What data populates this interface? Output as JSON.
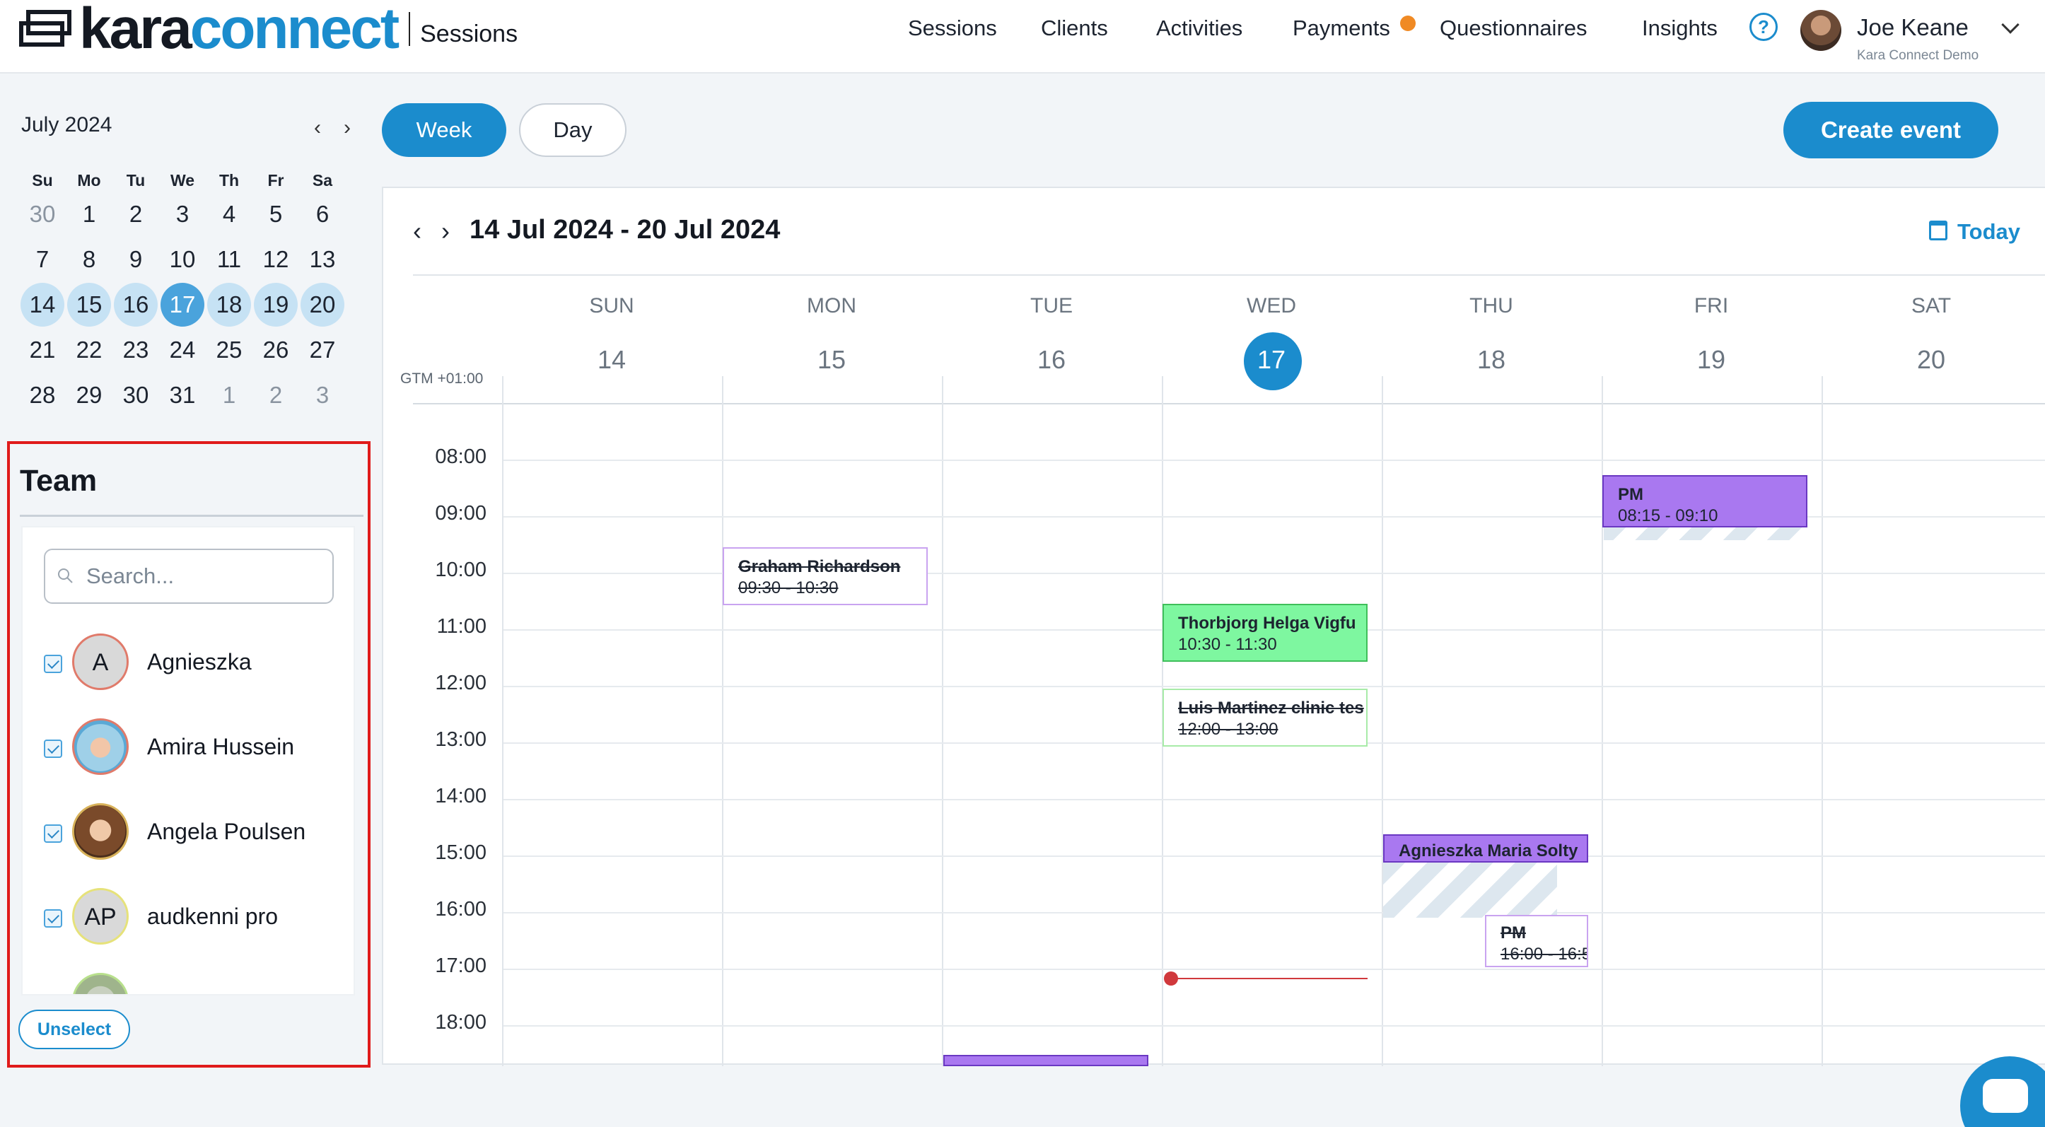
{
  "header": {
    "logo_part1": "kara",
    "logo_part2": "connect",
    "section": "Sessions",
    "nav": [
      "Sessions",
      "Clients",
      "Activities",
      "Payments",
      "Questionnaires",
      "Insights"
    ],
    "payments_badge": "!",
    "help": "?",
    "user_name": "Joe Keane",
    "user_org": "Kara Connect Demo"
  },
  "mini_calendar": {
    "title": "July 2024",
    "prev": "‹",
    "next": "›",
    "dow": [
      "Su",
      "Mo",
      "Tu",
      "We",
      "Th",
      "Fr",
      "Sa"
    ],
    "weeks": [
      [
        "30",
        "1",
        "2",
        "3",
        "4",
        "5",
        "6"
      ],
      [
        "7",
        "8",
        "9",
        "10",
        "11",
        "12",
        "13"
      ],
      [
        "14",
        "15",
        "16",
        "17",
        "18",
        "19",
        "20"
      ],
      [
        "21",
        "22",
        "23",
        "24",
        "25",
        "26",
        "27"
      ],
      [
        "28",
        "29",
        "30",
        "31",
        "1",
        "2",
        "3"
      ]
    ],
    "today": "17"
  },
  "team": {
    "title": "Team",
    "search_placeholder": "Search...",
    "members": [
      {
        "name": "Agnieszka",
        "initials": "A"
      },
      {
        "name": "Amira Hussein",
        "initials": ""
      },
      {
        "name": "Angela Poulsen",
        "initials": ""
      },
      {
        "name": "audkenni pro",
        "initials": "AP"
      }
    ],
    "unselect_label": "Unselect"
  },
  "toolbar": {
    "week_label": "Week",
    "day_label": "Day",
    "create_label": "Create event"
  },
  "calendar": {
    "prev": "‹",
    "next": "›",
    "range": "14 Jul 2024 - 20 Jul 2024",
    "today_label": "Today",
    "timezone": "GTM +01:00",
    "days": [
      {
        "dow": "SUN",
        "num": "14"
      },
      {
        "dow": "MON",
        "num": "15"
      },
      {
        "dow": "TUE",
        "num": "16"
      },
      {
        "dow": "WED",
        "num": "17"
      },
      {
        "dow": "THU",
        "num": "18"
      },
      {
        "dow": "FRI",
        "num": "19"
      },
      {
        "dow": "SAT",
        "num": "20"
      }
    ],
    "hours": [
      "08:00",
      "09:00",
      "10:00",
      "11:00",
      "12:00",
      "13:00",
      "14:00",
      "15:00",
      "16:00",
      "17:00",
      "18:00"
    ],
    "events": [
      {
        "title": "Graham Richardson",
        "time": "09:30 - 10:30"
      },
      {
        "title": "Thorbjorg Helga Vigfu",
        "time": "10:30 - 11:30"
      },
      {
        "title": "Luis Martinez clinic tes",
        "time": "12:00 - 13:00"
      },
      {
        "title": "PM",
        "time": "08:15 - 09:10"
      },
      {
        "title": "Agnieszka Maria Solty",
        "time": ""
      },
      {
        "title": "PM",
        "time": "16:00 - 16:5"
      }
    ]
  }
}
